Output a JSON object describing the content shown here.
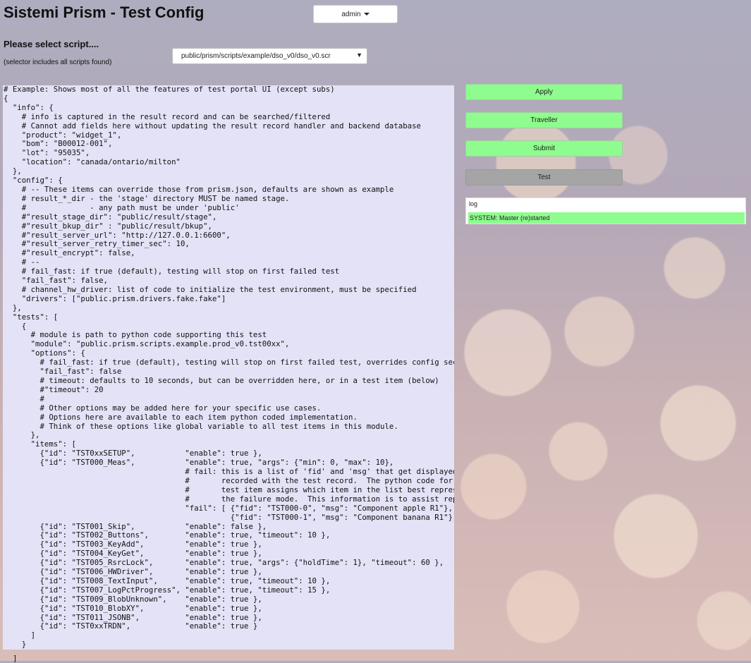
{
  "app": {
    "title": "Sistemi Prism - Test Config"
  },
  "user_menu": {
    "label": "admin",
    "caret_icon": "caret-down-icon"
  },
  "script_selector": {
    "prompt": "Please select script....",
    "note": "(selector includes all scripts found)",
    "selected": "public/prism/scripts/example/dso_v0/dso_v0.scr"
  },
  "actions": {
    "apply": "Apply",
    "traveller": "Traveller",
    "submit": "Submit",
    "test": "Test"
  },
  "colors": {
    "button_active": "#8efc8e",
    "button_disabled": "#a5a5a5",
    "code_bg": "#e4e2f6"
  },
  "log": {
    "title": "log",
    "entries": [
      "SYSTEM: Master (re)started"
    ]
  },
  "script_content": "# Example: Shows most of all the features of test portal UI (except subs)\n{\n  \"info\": {\n    # info is captured in the result record and can be searched/filtered\n    # Cannot add fields here without updating the result record handler and backend database\n    \"product\": \"widget_1\",\n    \"bom\": \"B00012-001\",\n    \"lot\": \"95035\",\n    \"location\": \"canada/ontario/milton\"\n  },\n  \"config\": {\n    # -- These items can override those from prism.json, defaults are shown as example\n    # result_*_dir - the 'stage' directory MUST be named stage.\n    #              - any path must be under 'public'\n    #\"result_stage_dir\": \"public/result/stage\",\n    #\"result_bkup_dir\" : \"public/result/bkup\",\n    #\"result_server_url\": \"http://127.0.0.1:6600\",\n    #\"result_server_retry_timer_sec\": 10,\n    #\"result_encrypt\": false,\n    # --\n    # fail_fast: if true (default), testing will stop on first failed test\n    \"fail_fast\": false,\n    # channel_hw_driver: list of code to initialize the test environment, must be specified\n    \"drivers\": [\"public.prism.drivers.fake.fake\"]\n  },\n  \"tests\": [\n    {\n      # module is path to python code supporting this test\n      \"module\": \"public.prism.scripts.example.prod_v0.tst00xx\",\n      \"options\": {\n        # fail_fast: if true (default), testing will stop on first failed test, overrides config section\n        \"fail_fast\": false\n        # timeout: defaults to 10 seconds, but can be overridden here, or in a test item (below)\n        #\"timeout\": 20\n        #\n        # Other options may be added here for your specific use cases.\n        # Options here are available to each item python coded implementation.\n        # Think of these options like global variable to all test items in this module.\n      },\n      \"items\": [\n        {\"id\": \"TST0xxSETUP\",           \"enable\": true },\n        {\"id\": \"TST000_Meas\",           \"enable\": true, \"args\": {\"min\": 0, \"max\": 10},\n                                        # fail: this is a list of 'fid' and 'msg' that get displayed\n                                        #       recorded with the test record.  The python code for\n                                        #       test item assigns which item in the list best represents\n                                        #       the failure mode.  This information is to assist repair\n                                        \"fail\": [ {\"fid\": \"TST000-0\", \"msg\": \"Component apple R1\"},\n                                                  {\"fid\": \"TST000-1\", \"msg\": \"Component banana R1\"}]},\n        {\"id\": \"TST001_Skip\",           \"enable\": false },\n        {\"id\": \"TST002_Buttons\",        \"enable\": true, \"timeout\": 10 },\n        {\"id\": \"TST003_KeyAdd\",         \"enable\": true },\n        {\"id\": \"TST004_KeyGet\",         \"enable\": true },\n        {\"id\": \"TST005_RsrcLock\",       \"enable\": true, \"args\": {\"holdTime\": 1}, \"timeout\": 60 },\n        {\"id\": \"TST006_HWDriver\",       \"enable\": true },\n        {\"id\": \"TST008_TextInput\",      \"enable\": true, \"timeout\": 10 },\n        {\"id\": \"TST007_LogPctProgress\", \"enable\": true, \"timeout\": 15 },\n        {\"id\": \"TST009_BlobUnknown\",    \"enable\": true },\n        {\"id\": \"TST010_BlobXY\",         \"enable\": true },\n        {\"id\": \"TST011_JSONB\",          \"enable\": true },\n        {\"id\": \"TST0xxTRDN\",            \"enable\": true }\n      ]\n    }",
  "script_trailing": "]"
}
